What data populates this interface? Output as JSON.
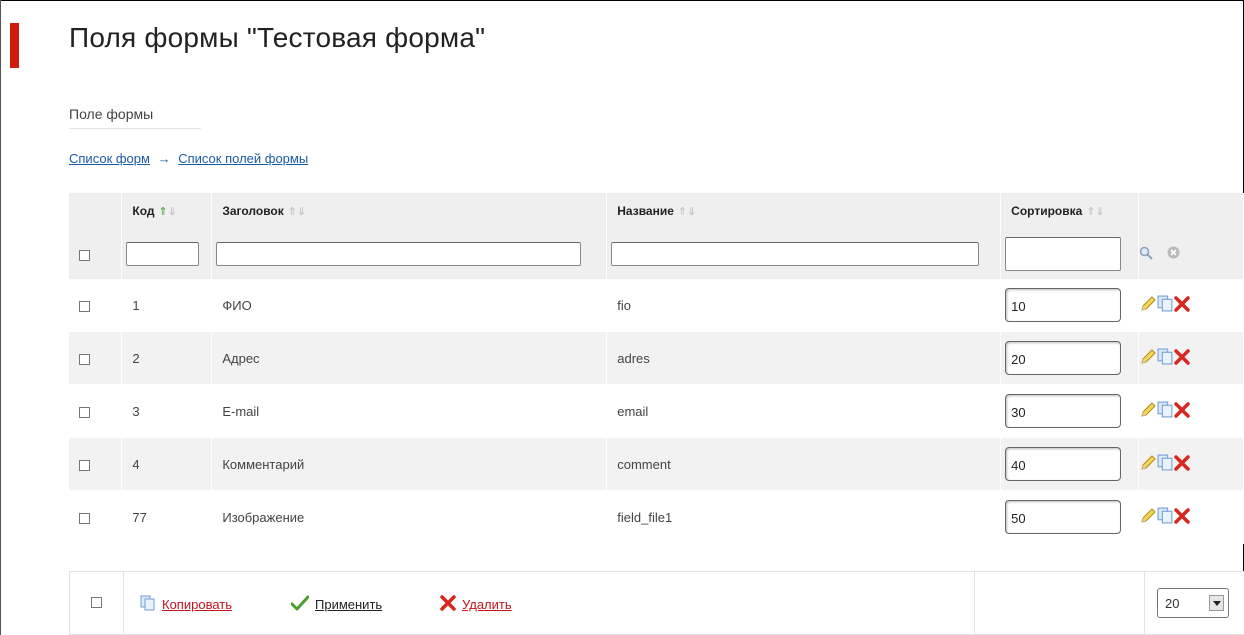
{
  "page": {
    "title": "Поля формы \"Тестовая форма\"",
    "tab_label": "Поле формы"
  },
  "breadcrumbs": {
    "items": [
      "Список форм",
      "Список полей формы"
    ],
    "separator": "→"
  },
  "table": {
    "columns": {
      "code": "Код",
      "heading": "Заголовок",
      "name": "Название",
      "sort": "Сортировка"
    },
    "rows": [
      {
        "code": "1",
        "heading": "ФИО",
        "name": "fio",
        "sort": "10"
      },
      {
        "code": "2",
        "heading": "Адрес",
        "name": "adres",
        "sort": "20"
      },
      {
        "code": "3",
        "heading": "E-mail",
        "name": "email",
        "sort": "30"
      },
      {
        "code": "4",
        "heading": "Комментарий",
        "name": "comment",
        "sort": "40"
      },
      {
        "code": "77",
        "heading": "Изображение",
        "name": "field_file1",
        "sort": "50"
      }
    ]
  },
  "footer": {
    "copy_label": "Копировать",
    "apply_label": "Применить",
    "delete_label": "Удалить",
    "per_page": "20"
  },
  "colors": {
    "accent": "#d01c0d",
    "link": "#1a5aa6",
    "danger_link": "#c3141b",
    "header_bg": "#efefef"
  },
  "icons": [
    "search-icon",
    "clear-icon",
    "edit-pencil-icon",
    "copy-icon",
    "delete-icon",
    "checkmark-icon",
    "sort-up-arrow-icon",
    "sort-down-arrow-icon",
    "dropdown-arrow-icon"
  ]
}
